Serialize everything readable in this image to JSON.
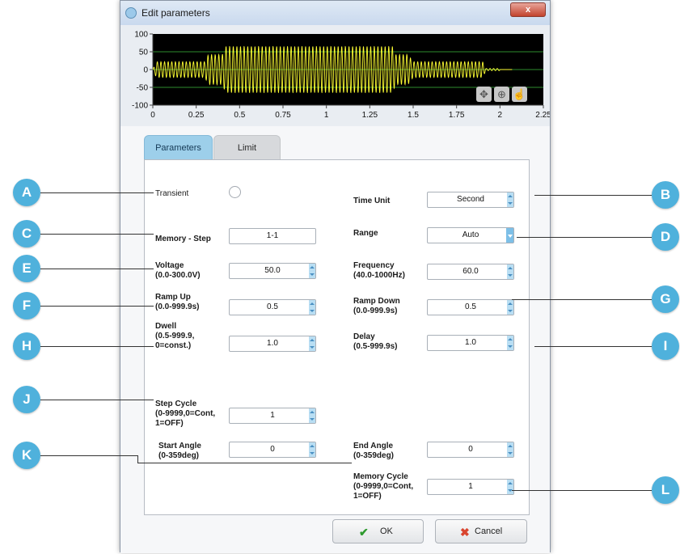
{
  "window": {
    "title": "Edit parameters",
    "close_label": "x"
  },
  "chart_data": {
    "type": "line",
    "title": "",
    "xlabel": "",
    "ylabel": "",
    "x_ticks": [
      "0",
      "0.25",
      "0.5",
      "0.75",
      "1",
      "1.25",
      "1.5",
      "1.75",
      "2",
      "2.25"
    ],
    "y_ticks": [
      "100",
      "50",
      "0",
      "-50",
      "-100"
    ],
    "xlim": [
      0,
      2.25
    ],
    "ylim": [
      -100,
      100
    ],
    "grid_y": [
      -50,
      0,
      50
    ],
    "series": [
      {
        "color": "#ffff33",
        "envelope": [
          {
            "x": 0.0,
            "amp": 0
          },
          {
            "x": 0.02,
            "amp": 22
          },
          {
            "x": 0.3,
            "amp": 22
          },
          {
            "x": 0.32,
            "amp": 42
          },
          {
            "x": 0.4,
            "amp": 42
          },
          {
            "x": 0.42,
            "amp": 65
          },
          {
            "x": 1.38,
            "amp": 65
          },
          {
            "x": 1.4,
            "amp": 42
          },
          {
            "x": 1.47,
            "amp": 42
          },
          {
            "x": 1.5,
            "amp": 22
          },
          {
            "x": 1.9,
            "amp": 22
          },
          {
            "x": 1.92,
            "amp": 3
          },
          {
            "x": 2.0,
            "amp": 3
          }
        ],
        "frequency_hz": 60
      }
    ],
    "background": "#000000",
    "grid_color": "#2e8b2e"
  },
  "chart_tools": [
    "pan-icon",
    "zoom-icon",
    "hand-icon"
  ],
  "tabs": {
    "parameters": "Parameters",
    "limit": "Limit"
  },
  "form": {
    "transient": "Transient",
    "time_unit": {
      "label": "Time Unit",
      "value": "Second"
    },
    "memory_step": {
      "label": "Memory - Step",
      "value": "1-1"
    },
    "range": {
      "label": "Range",
      "value": "Auto"
    },
    "voltage": {
      "label1": "Voltage",
      "label2": "(0.0-300.0V)",
      "value": "50.0"
    },
    "frequency": {
      "label1": "Frequency",
      "label2": "(40.0-1000Hz)",
      "value": "60.0"
    },
    "ramp_up": {
      "label1": "Ramp Up",
      "label2": "(0.0-999.9s)",
      "value": "0.5"
    },
    "ramp_down": {
      "label1": "Ramp Down",
      "label2": "(0.0-999.9s)",
      "value": "0.5"
    },
    "dwell": {
      "label1": "Dwell",
      "label2": "(0.5-999.9,",
      "label3": "0=const.)",
      "value": "1.0"
    },
    "delay": {
      "label1": "Delay",
      "label2": "(0.5-999.9s)",
      "value": "1.0"
    },
    "step_cycle": {
      "label1": "Step Cycle",
      "label2": "(0-9999,0=Cont,",
      "label3": "1=OFF)",
      "value": "1"
    },
    "start_angle": {
      "label1": "Start Angle",
      "label2": "(0-359deg)",
      "value": "0"
    },
    "end_angle": {
      "label1": "End Angle",
      "label2": "(0-359deg)",
      "value": "0"
    },
    "memory_cycle": {
      "label1": "Memory Cycle",
      "label2": "(0-9999,0=Cont,",
      "label3": "1=OFF)",
      "value": "1"
    }
  },
  "buttons": {
    "ok": "OK",
    "cancel": "Cancel"
  },
  "callouts": [
    "A",
    "B",
    "C",
    "D",
    "E",
    "F",
    "G",
    "H",
    "I",
    "J",
    "K",
    "L"
  ],
  "colors": {
    "callout": "#4fb1dc",
    "tab_active": "#9dcfea",
    "spin": "#b9def3"
  }
}
